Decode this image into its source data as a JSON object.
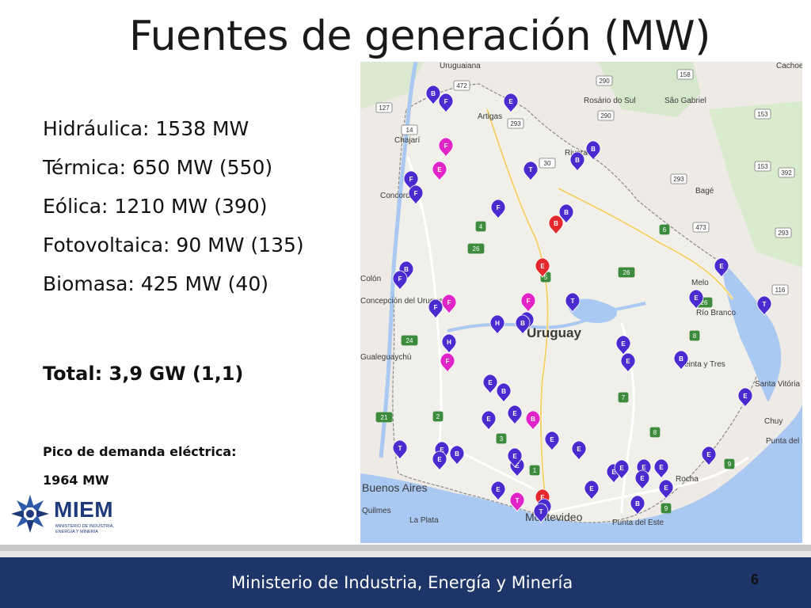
{
  "slide": {
    "title": "Fuentes de generación (MW)",
    "page_number": "6"
  },
  "sources": [
    {
      "label": "Hidráulica: 1538 MW"
    },
    {
      "label": "Térmica: 650 MW (550)"
    },
    {
      "label": "Eólica: 1210 MW (390)"
    },
    {
      "label": "Fotovoltaica: 90 MW (135)"
    },
    {
      "label": "Biomasa: 425 MW (40)"
    }
  ],
  "total": "Total: 3,9 GW (1,1)",
  "peak": {
    "label": "Pico de demanda eléctrica:",
    "value": "1964 MW"
  },
  "logo": {
    "name": "MIEM",
    "subtitle_line1": "MINISTERIO DE INDUSTRIA,",
    "subtitle_line2": "ENERGÍA Y MINERÍA"
  },
  "footer": {
    "text": "Ministerio de Industria, Energía y Minería"
  },
  "map": {
    "country_label": "Uruguay",
    "colors": {
      "land": "#eeebe6",
      "water": "#a9c8f2",
      "pin_blue": "#4a2bd0",
      "pin_magenta": "#e024c8",
      "pin_red": "#e5282b"
    },
    "places": [
      {
        "name": "Uruguaiana"
      },
      {
        "name": "Rosário do Sul"
      },
      {
        "name": "São Gabriel"
      },
      {
        "name": "Artigas"
      },
      {
        "name": "Chajarí"
      },
      {
        "name": "Concordia"
      },
      {
        "name": "Rivera"
      },
      {
        "name": "Bagé"
      },
      {
        "name": "Melo"
      },
      {
        "name": "Colón"
      },
      {
        "name": "Concepción del Uruguay"
      },
      {
        "name": "Gualeguaychú"
      },
      {
        "name": "Río Branco"
      },
      {
        "name": "Treinta y Tres"
      },
      {
        "name": "Santa Vitória do Palmar"
      },
      {
        "name": "Chuy"
      },
      {
        "name": "Punta del Diablo"
      },
      {
        "name": "Buenos Aires"
      },
      {
        "name": "Quilmes"
      },
      {
        "name": "La Plata"
      },
      {
        "name": "Montevideo"
      },
      {
        "name": "Rocha"
      },
      {
        "name": "Punta del Este"
      },
      {
        "name": "Cachoeira do Sul"
      }
    ],
    "route_labels": [
      "127",
      "472",
      "290",
      "158",
      "14",
      "293",
      "30",
      "290",
      "153",
      "392",
      "153",
      "293",
      "4",
      "6",
      "26",
      "473",
      "293",
      "26",
      "5",
      "116",
      "26",
      "8",
      "24",
      "7",
      "21",
      "2",
      "3",
      "8",
      "9",
      "8",
      "9",
      "1"
    ],
    "pins": [
      {
        "letter": "B",
        "kind": "biomasa"
      },
      {
        "letter": "F",
        "kind": "fotovoltaica"
      },
      {
        "letter": "E",
        "kind": "eolica"
      },
      {
        "letter": "F",
        "kind": "fotovoltaica-m"
      },
      {
        "letter": "E",
        "kind": "eolica-m"
      },
      {
        "letter": "T",
        "kind": "termica"
      },
      {
        "letter": "B",
        "kind": "biomasa"
      },
      {
        "letter": "B",
        "kind": "biomasa"
      },
      {
        "letter": "F",
        "kind": "fotovoltaica"
      },
      {
        "letter": "F",
        "kind": "fotovoltaica"
      },
      {
        "letter": "F",
        "kind": "fotovoltaica"
      },
      {
        "letter": "B",
        "kind": "biomasa"
      },
      {
        "letter": "B",
        "kind": "biomasa-red"
      },
      {
        "letter": "E",
        "kind": "eolica"
      },
      {
        "letter": "F",
        "kind": "fotovoltaica-m"
      },
      {
        "letter": "B",
        "kind": "biomasa"
      },
      {
        "letter": "F",
        "kind": "fotovoltaica"
      },
      {
        "letter": "E",
        "kind": "eolica"
      },
      {
        "letter": "T",
        "kind": "termica"
      },
      {
        "letter": "F",
        "kind": "fotovoltaica"
      },
      {
        "letter": "F",
        "kind": "fotovoltaica-m"
      },
      {
        "letter": "H",
        "kind": "hidraulica"
      },
      {
        "letter": "H",
        "kind": "hidraulica"
      },
      {
        "letter": "E",
        "kind": "eolica-red"
      },
      {
        "letter": "E",
        "kind": "eolica"
      },
      {
        "letter": "T",
        "kind": "termica"
      },
      {
        "letter": "B",
        "kind": "biomasa"
      },
      {
        "letter": "F",
        "kind": "fotovoltaica-m"
      },
      {
        "letter": "H",
        "kind": "hidraulica"
      },
      {
        "letter": "E",
        "kind": "eolica"
      },
      {
        "letter": "E",
        "kind": "eolica"
      },
      {
        "letter": "B",
        "kind": "biomasa"
      },
      {
        "letter": "E",
        "kind": "eolica"
      },
      {
        "letter": "B",
        "kind": "biomasa"
      },
      {
        "letter": "E",
        "kind": "eolica"
      },
      {
        "letter": "E",
        "kind": "eolica"
      },
      {
        "letter": "B",
        "kind": "biomasa-m"
      },
      {
        "letter": "E",
        "kind": "eolica"
      },
      {
        "letter": "E",
        "kind": "eolica"
      },
      {
        "letter": "E",
        "kind": "eolica"
      },
      {
        "letter": "E",
        "kind": "eolica"
      },
      {
        "letter": "B",
        "kind": "biomasa"
      },
      {
        "letter": "E",
        "kind": "eolica"
      },
      {
        "letter": "E",
        "kind": "eolica"
      },
      {
        "letter": "E",
        "kind": "eolica"
      },
      {
        "letter": "E",
        "kind": "eolica"
      },
      {
        "letter": "E",
        "kind": "eolica"
      },
      {
        "letter": "E",
        "kind": "eolica"
      },
      {
        "letter": "E",
        "kind": "eolica"
      },
      {
        "letter": "E",
        "kind": "eolica"
      },
      {
        "letter": "E",
        "kind": "eolica"
      },
      {
        "letter": "B",
        "kind": "biomasa"
      },
      {
        "letter": "E",
        "kind": "eolica"
      },
      {
        "letter": "E",
        "kind": "eolica"
      },
      {
        "letter": "T",
        "kind": "termica-m"
      },
      {
        "letter": "E",
        "kind": "eolica-red"
      },
      {
        "letter": "T",
        "kind": "termica"
      },
      {
        "letter": "T",
        "kind": "termica"
      },
      {
        "letter": "E",
        "kind": "eolica"
      },
      {
        "letter": "T",
        "kind": "termica"
      }
    ]
  }
}
